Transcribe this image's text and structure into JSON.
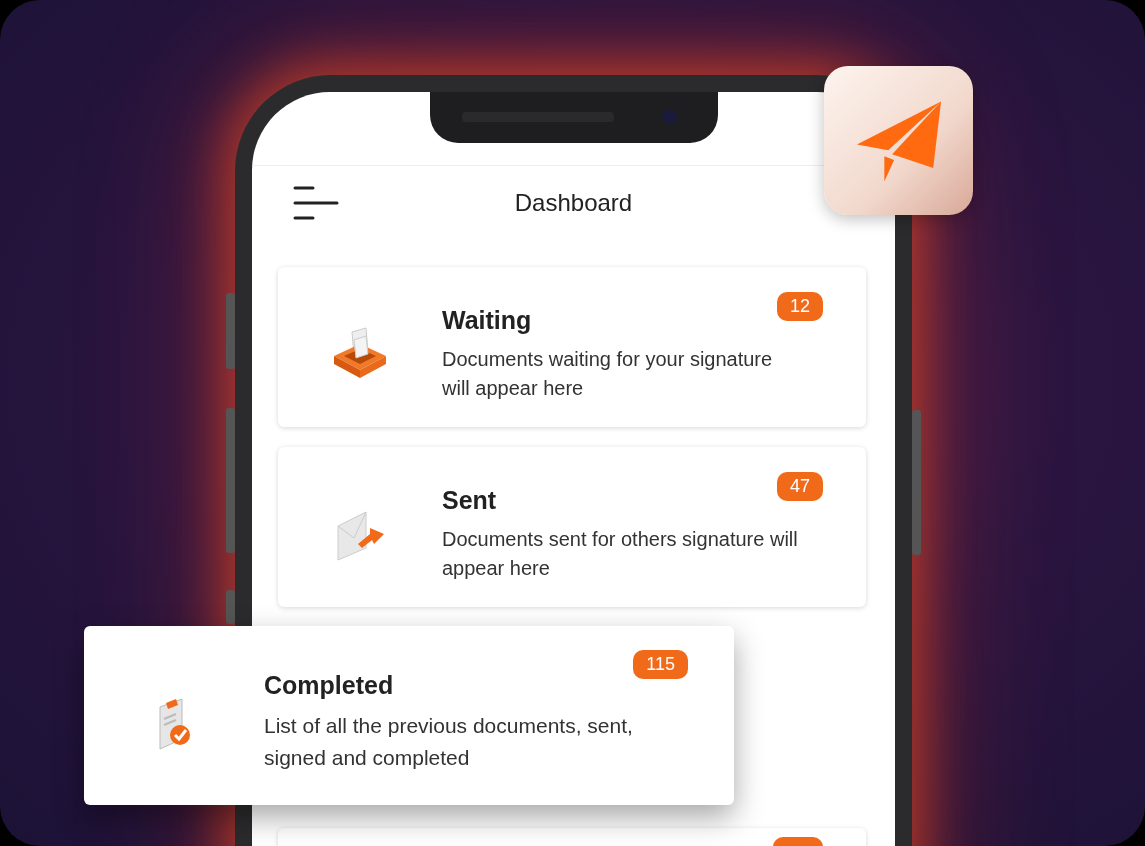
{
  "screen": {
    "title": "Dashboard"
  },
  "cards": [
    {
      "kind": "inbox",
      "title": "Waiting",
      "description": "Documents waiting for your signature will appear here",
      "count": "12"
    },
    {
      "kind": "sent",
      "title": "Sent",
      "description": "Documents sent for others signature will appear here",
      "count": "47"
    }
  ],
  "highlight_card": {
    "kind": "completed",
    "title": "Completed",
    "description": "List of all the previous documents, sent, signed and completed",
    "count": "115"
  }
}
